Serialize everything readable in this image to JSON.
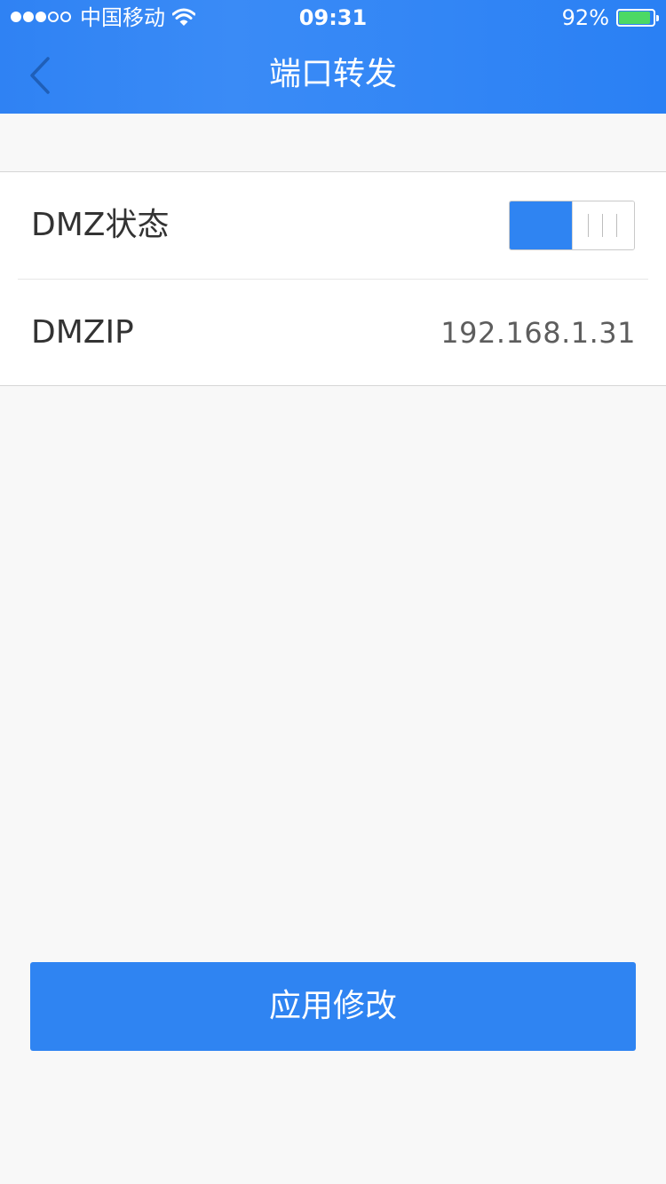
{
  "status_bar": {
    "carrier": "中国移动",
    "time": "09:31",
    "battery_percent": "92%",
    "battery_level": 0.92,
    "signal_filled": 3,
    "signal_total": 5
  },
  "nav": {
    "title": "端口转发",
    "back_icon": "chevron-left-icon"
  },
  "settings": {
    "dmz_status": {
      "label": "DMZ状态",
      "enabled": true
    },
    "dmz_ip": {
      "label": "DMZIP",
      "value": "192.168.1.31"
    }
  },
  "apply_button": {
    "label": "应用修改"
  },
  "colors": {
    "primary": "#2f84f2",
    "battery_fill": "#4cd964",
    "page_background": "#f8f8f8"
  }
}
